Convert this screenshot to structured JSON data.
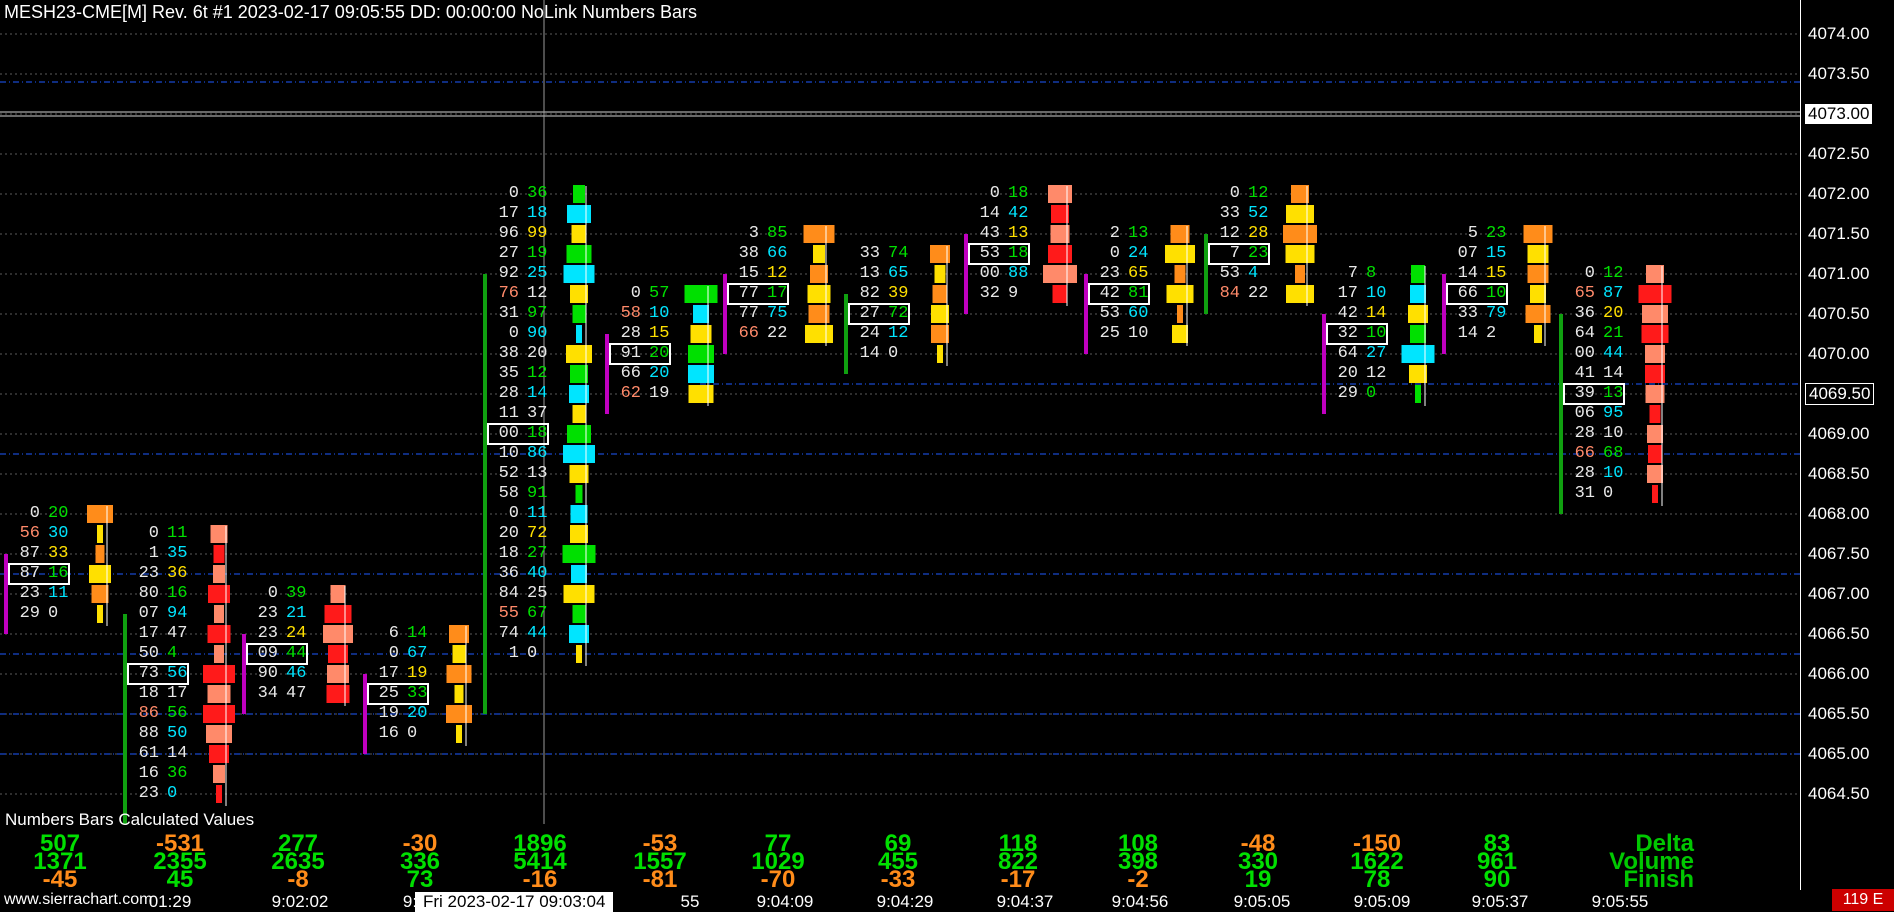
{
  "header": {
    "title": "MESH23-CME[M]  Rev. 6t  #1 2023-02-17 09:05:55 DD: 00:00:00 NoLink Numbers Bars"
  },
  "price_axis": {
    "labels": [
      "4074.00",
      "4073.50",
      "4073.00",
      "4072.50",
      "4072.00",
      "4071.50",
      "4071.00",
      "4070.50",
      "4070.00",
      "4069.50",
      "4069.00",
      "4068.50",
      "4068.00",
      "4067.50",
      "4067.00",
      "4066.50",
      "4066.00",
      "4065.50",
      "4065.00",
      "4064.50"
    ],
    "current_price": "4073.00",
    "cursor_price": "4069.50"
  },
  "time_axis": {
    "watermark": "www.sierrachart.com",
    "labels": [
      "01:29",
      "9:02:02",
      "9:",
      "55",
      "9:04:09",
      "9:04:29",
      "9:04:37",
      "9:04:56",
      "9:05:05",
      "9:05:09",
      "9:05:37",
      "9:05:55"
    ],
    "cursor_label": "Fri 2023-02-17  09:03:04",
    "countdown": "119 E"
  },
  "colors": {
    "background": "#000000",
    "grid": "#5a5a5a",
    "blue_line": "#1e5aff",
    "green": "#00e000",
    "dark_green": "#10a010",
    "red": "#ff1a1a",
    "salmon": "#ff8a6a",
    "orange": "#ff8c1a",
    "cyan": "#00e5ff",
    "yellow": "#ffe000",
    "magenta": "#c000c0",
    "light_yellow": "#ffe08a"
  },
  "chart_data": {
    "type": "table",
    "title": "MESH23-CME[M] Numbers Bars",
    "columns": [
      {
        "time": "",
        "cells": [
          [
            "0",
            "20"
          ],
          [
            "56",
            "30"
          ],
          [
            "87",
            "33"
          ],
          [
            "87",
            "16"
          ],
          [
            "23",
            "11"
          ],
          [
            "29",
            "0"
          ]
        ],
        "top": 4068.0
      },
      {
        "time": "01:29",
        "cells": [
          [
            "0",
            "11"
          ],
          [
            "1",
            "35"
          ],
          [
            "23",
            "36"
          ],
          [
            "80",
            "16"
          ],
          [
            "07",
            "94"
          ],
          [
            "17",
            "47"
          ],
          [
            "50",
            "4"
          ],
          [
            "73",
            "56"
          ],
          [
            "18",
            "17"
          ],
          [
            "86",
            "56"
          ],
          [
            "88",
            "50"
          ],
          [
            "61",
            "14"
          ],
          [
            "16",
            "36"
          ],
          [
            "23",
            "0"
          ]
        ],
        "top": 4067.75
      },
      {
        "time": "9:02:02",
        "cells": [
          [
            "0",
            "39"
          ],
          [
            "23",
            "21"
          ],
          [
            "23",
            "24"
          ],
          [
            "09",
            "44"
          ],
          [
            "90",
            "46"
          ],
          [
            "34",
            "47"
          ]
        ],
        "top": 4067.0
      },
      {
        "time": "9:",
        "cells": [
          [
            "6",
            "14"
          ],
          [
            "0",
            "67"
          ],
          [
            "17",
            "19"
          ],
          [
            "25",
            "33"
          ],
          [
            "19",
            "20"
          ],
          [
            "16",
            "0"
          ]
        ],
        "top": 4066.5
      },
      {
        "time": "",
        "cells": [
          [
            "0",
            "36"
          ],
          [
            "17",
            "18"
          ],
          [
            "96",
            "99"
          ],
          [
            "27",
            "19"
          ],
          [
            "92",
            "25"
          ],
          [
            "76",
            "12"
          ],
          [
            "31",
            "97"
          ],
          [
            "0",
            "90"
          ],
          [
            "38",
            "20"
          ],
          [
            "35",
            "12"
          ],
          [
            "28",
            "14"
          ],
          [
            "11",
            "37"
          ],
          [
            "00",
            "18"
          ],
          [
            "10",
            "86"
          ],
          [
            "52",
            "13"
          ],
          [
            "58",
            "91"
          ],
          [
            "0",
            "11"
          ],
          [
            "20",
            "72"
          ],
          [
            "18",
            "27"
          ],
          [
            "36",
            "40"
          ],
          [
            "84",
            "25"
          ],
          [
            "55",
            "67"
          ],
          [
            "74",
            "44"
          ],
          [
            "1",
            "0"
          ]
        ],
        "top": 4072.0
      },
      {
        "time": "55",
        "cells": [
          [
            "0",
            "57"
          ],
          [
            "58",
            "10"
          ],
          [
            "28",
            "15"
          ],
          [
            "91",
            "20"
          ],
          [
            "66",
            "20"
          ],
          [
            "62",
            "19"
          ]
        ],
        "top": 4070.75
      },
      {
        "time": "9:04:09",
        "cells": [
          [
            "3",
            "85"
          ],
          [
            "38",
            "66"
          ],
          [
            "15",
            "12"
          ],
          [
            "77",
            "17"
          ],
          [
            "77",
            "75"
          ],
          [
            "66",
            "22"
          ]
        ],
        "top": 4071.5
      },
      {
        "time": "9:04:29",
        "cells": [
          [
            "33",
            "74"
          ],
          [
            "13",
            "65"
          ],
          [
            "82",
            "39"
          ],
          [
            "27",
            "72"
          ],
          [
            "24",
            "12"
          ],
          [
            "14",
            "0"
          ]
        ],
        "top": 4071.25
      },
      {
        "time": "9:04:37",
        "cells": [
          [
            "0",
            "18"
          ],
          [
            "14",
            "42"
          ],
          [
            "43",
            "13"
          ],
          [
            "53",
            "18"
          ],
          [
            "00",
            "88"
          ],
          [
            "32",
            "9"
          ]
        ],
        "top": 4072.0
      },
      {
        "time": "9:04:56",
        "cells": [
          [
            "2",
            "13"
          ],
          [
            "0",
            "24"
          ],
          [
            "23",
            "65"
          ],
          [
            "42",
            "81"
          ],
          [
            "53",
            "60"
          ],
          [
            "25",
            "10"
          ]
        ],
        "top": 4071.5
      },
      {
        "time": "9:05:05",
        "cells": [
          [
            "0",
            "12"
          ],
          [
            "33",
            "52"
          ],
          [
            "12",
            "28"
          ],
          [
            "7",
            "23"
          ],
          [
            "53",
            "4"
          ],
          [
            "84",
            "22"
          ]
        ],
        "top": 4072.0
      },
      {
        "time": "9:05:09",
        "cells": [
          [
            "7",
            "8"
          ],
          [
            "17",
            "10"
          ],
          [
            "42",
            "14"
          ],
          [
            "32",
            "10"
          ],
          [
            "64",
            "27"
          ],
          [
            "20",
            "12"
          ],
          [
            "29",
            "0"
          ]
        ],
        "top": 4071.0
      },
      {
        "time": "9:05:37",
        "cells": [
          [
            "5",
            "23"
          ],
          [
            "07",
            "15"
          ],
          [
            "14",
            "15"
          ],
          [
            "66",
            "10"
          ],
          [
            "33",
            "79"
          ],
          [
            "14",
            "2"
          ]
        ],
        "top": 4071.5
      },
      {
        "time": "9:05:55",
        "cells": [
          [
            "0",
            "12"
          ],
          [
            "65",
            "87"
          ],
          [
            "36",
            "20"
          ],
          [
            "64",
            "21"
          ],
          [
            "00",
            "44"
          ],
          [
            "41",
            "14"
          ],
          [
            "39",
            "13"
          ],
          [
            "06",
            "95"
          ],
          [
            "28",
            "10"
          ],
          [
            "66",
            "68"
          ],
          [
            "28",
            "10"
          ],
          [
            "31",
            "0"
          ]
        ],
        "top": 4071.0
      }
    ]
  },
  "subgraph": {
    "title": "Numbers Bars Calculated Values",
    "row_names": [
      "Delta",
      "Volume",
      "Finish"
    ],
    "delta": [
      "507",
      "-531",
      "277",
      "-30",
      "1896",
      "-53",
      "77",
      "69",
      "118",
      "108",
      "-48",
      "-150",
      "83",
      ""
    ],
    "volume": [
      "1371",
      "2355",
      "2635",
      "336",
      "5414",
      "1557",
      "1029",
      "455",
      "822",
      "398",
      "330",
      "1622",
      "961",
      ""
    ],
    "finish": [
      "-45",
      "45",
      "-8",
      "73",
      "-16",
      "-81",
      "-70",
      "-33",
      "-17",
      "-2",
      "19",
      "78",
      "90",
      ""
    ]
  }
}
